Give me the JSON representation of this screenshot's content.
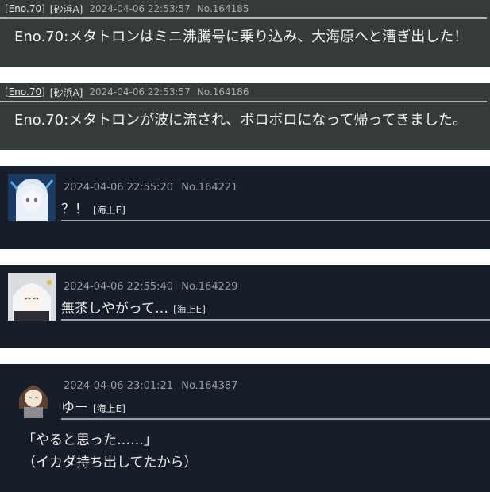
{
  "system_logs": [
    {
      "eno": "Eno.70",
      "area": "[砂浜A]",
      "timestamp": "2024-04-06 22:53:57",
      "number": "No.164185",
      "message": "Eno.70:メタトロンはミニ沸騰号に乗り込み、大海原へと漕ぎ出した！"
    },
    {
      "eno": "Eno.70",
      "area": "[砂浜A]",
      "timestamp": "2024-04-06 22:53:57",
      "number": "No.164186",
      "message": "Eno.70:メタトロンが波に流され、ボロボロになって帰ってきました。"
    }
  ],
  "posts": [
    {
      "timestamp": "2024-04-06 22:55:20",
      "number": "No.164221",
      "text": "？！",
      "location": "[海上E]",
      "avatar": "avatar-white-hair-character"
    },
    {
      "timestamp": "2024-04-06 22:55:40",
      "number": "No.164229",
      "text": "無茶しやがって…",
      "location": "[海上E]",
      "avatar": "avatar-white-hair-smiling"
    },
    {
      "timestamp": "2024-04-06 23:01:21",
      "number": "No.164387",
      "text": "ゆー",
      "location": "[海上E]",
      "avatar": "avatar-brown-hair-character",
      "body_lines": [
        "「やると思った……」",
        "（イカダ持ち出してたから）"
      ]
    }
  ],
  "colors": {
    "system_bg": "#353b37",
    "post_bg": "#161e29",
    "meta_text": "#9aa0a8"
  }
}
